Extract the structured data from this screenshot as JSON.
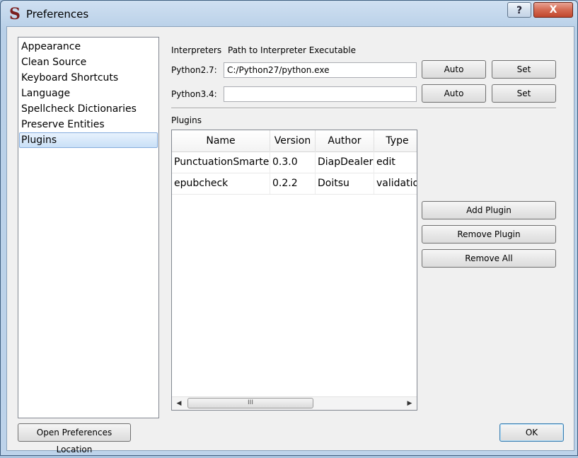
{
  "window": {
    "title": "Preferences",
    "app_icon": "S",
    "help_label": "?",
    "close_label": "X"
  },
  "sidebar": {
    "items": [
      {
        "label": "Appearance"
      },
      {
        "label": "Clean Source"
      },
      {
        "label": "Keyboard Shortcuts"
      },
      {
        "label": "Language"
      },
      {
        "label": "Spellcheck Dictionaries"
      },
      {
        "label": "Preserve Entities"
      },
      {
        "label": "Plugins",
        "selected": true
      }
    ]
  },
  "interpreters": {
    "heading_left": "Interpreters",
    "heading_right": "Path to Interpreter Executable",
    "rows": [
      {
        "label": "Python2.7:",
        "value": "C:/Python27/python.exe",
        "auto_label": "Auto",
        "set_label": "Set"
      },
      {
        "label": "Python3.4:",
        "value": "",
        "auto_label": "Auto",
        "set_label": "Set"
      }
    ]
  },
  "plugins": {
    "heading": "Plugins",
    "columns": [
      "Name",
      "Version",
      "Author",
      "Type"
    ],
    "rows": [
      [
        "PunctuationSmarten",
        "0.3.0",
        "DiapDealer",
        "edit"
      ],
      [
        "epubcheck",
        "0.2.2",
        "Doitsu",
        "validation"
      ]
    ],
    "scroll_thumb_grip": "III",
    "add_label": "Add Plugin",
    "remove_label": "Remove Plugin",
    "remove_all_label": "Remove All"
  },
  "footer": {
    "open_location_label": "Open Preferences Location",
    "ok_label": "OK"
  },
  "colors": {
    "selection_bg": "#c9e0f7",
    "selection_border": "#84acdd",
    "close_button": "#c0462c"
  }
}
